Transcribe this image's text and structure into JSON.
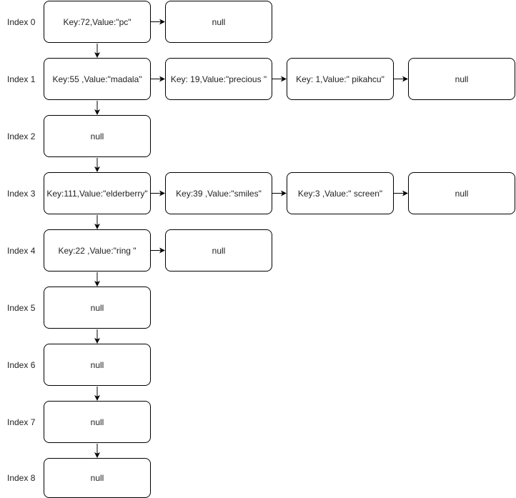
{
  "rows": [
    {
      "label": "Index 0",
      "nodes": [
        "Key:72,Value:\"pc\"",
        "null"
      ]
    },
    {
      "label": "Index 1",
      "nodes": [
        "Key:55 ,Value:\"madala\"",
        "Key: 19,Value:\"precious \"",
        "Key: 1,Value:\" pikahcu\"",
        "null"
      ]
    },
    {
      "label": "Index 2",
      "nodes": [
        "null"
      ]
    },
    {
      "label": "Index 3",
      "nodes": [
        "Key:111,Value:\"elderberry\"",
        "Key:39 ,Value:\"smiles\"",
        "Key:3 ,Value:\" screen\"",
        "null"
      ]
    },
    {
      "label": "Index 4",
      "nodes": [
        "Key:22 ,Value:\"ring \"",
        "null"
      ]
    },
    {
      "label": "Index 5",
      "nodes": [
        "null"
      ]
    },
    {
      "label": "Index 6",
      "nodes": [
        "null"
      ]
    },
    {
      "label": "Index 7",
      "nodes": [
        "null"
      ]
    },
    {
      "label": "Index 8",
      "nodes": [
        "null"
      ]
    }
  ]
}
